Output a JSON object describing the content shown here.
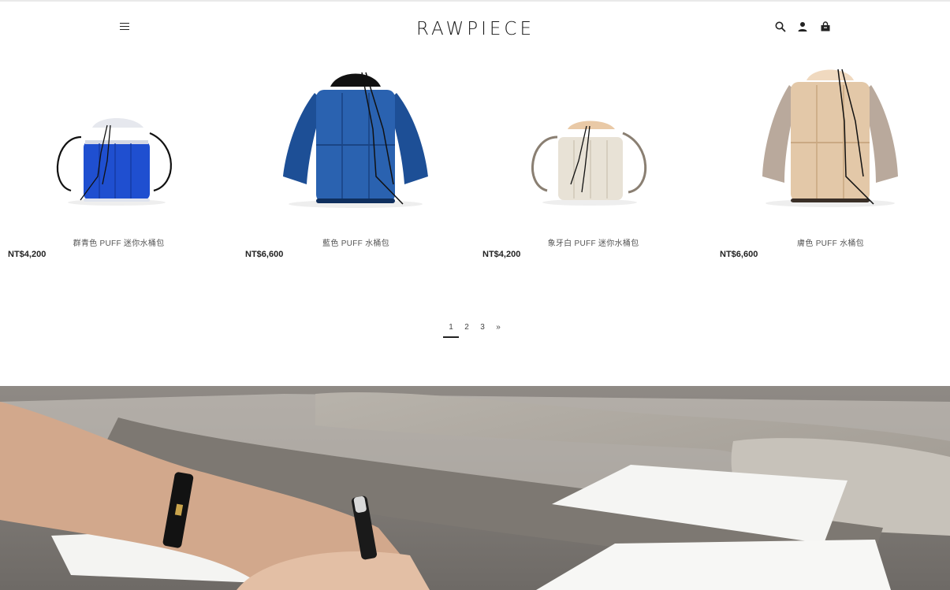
{
  "header": {
    "logo_text": "RAWPIECE",
    "menu_icon": "hamburger-menu-icon",
    "search_icon": "search-icon",
    "account_icon": "user-icon",
    "cart_icon": "shopping-bag-icon"
  },
  "products": [
    {
      "name": "群青色 PUFF 迷你水桶包",
      "price": "NT$4,200",
      "color": "#1f4fd0",
      "image": "blue mini bucket bag"
    },
    {
      "name": "藍色 PUFF 水桶包",
      "price": "NT$6,600",
      "color": "#2a62b0",
      "image": "blue bucket bag"
    },
    {
      "name": "象牙白 PUFF 迷你水桶包",
      "price": "NT$4,200",
      "color": "#e8e2d6",
      "image": "ivory mini bucket bag"
    },
    {
      "name": "膚色 PUFF 水桶包",
      "price": "NT$6,600",
      "color": "#e3c8a8",
      "image": "nude bucket bag"
    }
  ],
  "pagination": {
    "pages": [
      "1",
      "2",
      "3"
    ],
    "next": "»",
    "current": "1"
  },
  "banner": {
    "image": "hand sketching pattern on leather hides"
  }
}
